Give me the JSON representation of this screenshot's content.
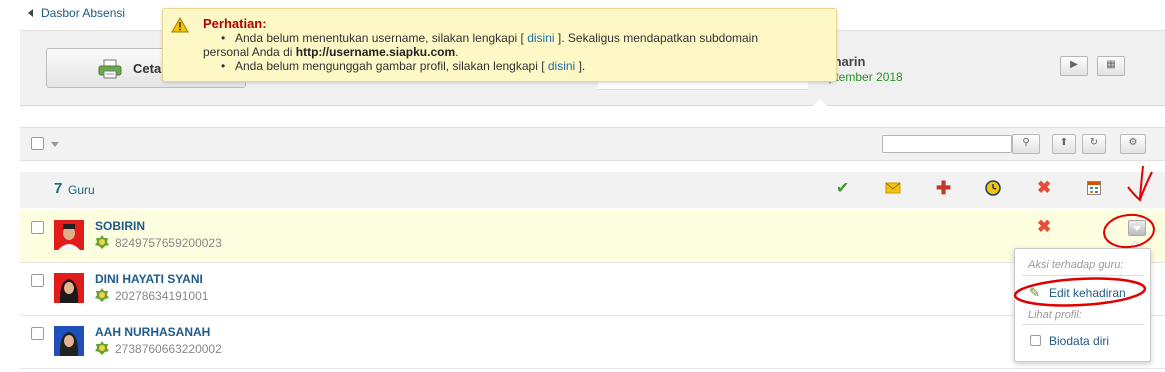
{
  "breadcrumb": {
    "label": "Dasbor Absensi"
  },
  "alert": {
    "title": "Perhatian:",
    "line1_pre": "Anda belum menentukan username, silakan lengkapi [",
    "line1_link": "disini",
    "line1_post": "]. Sekaligus mendapatkan subdomain",
    "line1_cont_pre": "personal Anda di ",
    "line1_cont_bold": "http://username.siapku.com",
    "line1_cont_post": ".",
    "line2_pre": "Anda belum mengunggah gambar profil, silakan lengkapi [",
    "line2_link": "disini",
    "line2_post": "]."
  },
  "toolbar": {
    "print_label": "Ceta"
  },
  "date": {
    "day": "marin",
    "date": "eptember 2018"
  },
  "list": {
    "count": "7",
    "count_label": "Guru",
    "header_icons": [
      "check-icon",
      "envelope-icon",
      "red-cross-icon",
      "clock-icon",
      "x-icon",
      "calendar-icon"
    ]
  },
  "rows": [
    {
      "name": "SOBIRIN",
      "nip": "8249757659200023"
    },
    {
      "name": "DINI HAYATI SYANI",
      "nip": "20278634191001"
    },
    {
      "name": "AAH NURHASANAH",
      "nip": "2738760663220002"
    }
  ],
  "menu": {
    "header1": "Aksi terhadap guru:",
    "item1": "Edit kehadiran",
    "header2": "Lihat profil:",
    "item2": "Biodata diri"
  },
  "colors": {
    "accent": "#1f5a8a",
    "alert_bg": "#fdf8c6",
    "alert_title": "#b30000",
    "annotation": "#e00000"
  }
}
